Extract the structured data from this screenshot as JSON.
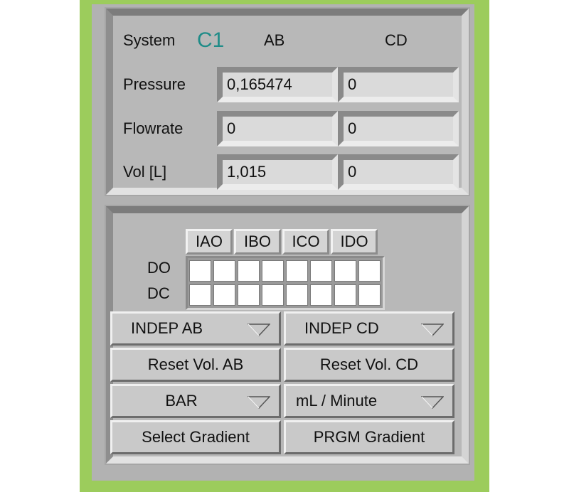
{
  "system": {
    "label": "System",
    "id": "C1",
    "col_ab": "AB",
    "col_cd": "CD"
  },
  "readings": [
    {
      "label": "Pressure",
      "ab": "0,165474",
      "cd": "0"
    },
    {
      "label": "Flowrate",
      "ab": "0",
      "cd": "0"
    },
    {
      "label": "Vol [L]",
      "ab": "1,015",
      "cd": "0"
    }
  ],
  "channels": [
    "IAO",
    "IBO",
    "ICO",
    "IDO"
  ],
  "grid": {
    "row_do": "DO",
    "row_dc": "DC"
  },
  "controls": {
    "mode_ab": "INDEP AB",
    "mode_cd": "INDEP CD",
    "reset_ab": "Reset Vol. AB",
    "reset_cd": "Reset Vol. CD",
    "pressure_unit": "BAR",
    "flow_unit": "mL / Minute",
    "select_gradient": "Select Gradient",
    "prgm_gradient": "PRGM Gradient"
  },
  "colors": {
    "frame": "#9ccc5c",
    "system_id": "#1f8c88"
  }
}
